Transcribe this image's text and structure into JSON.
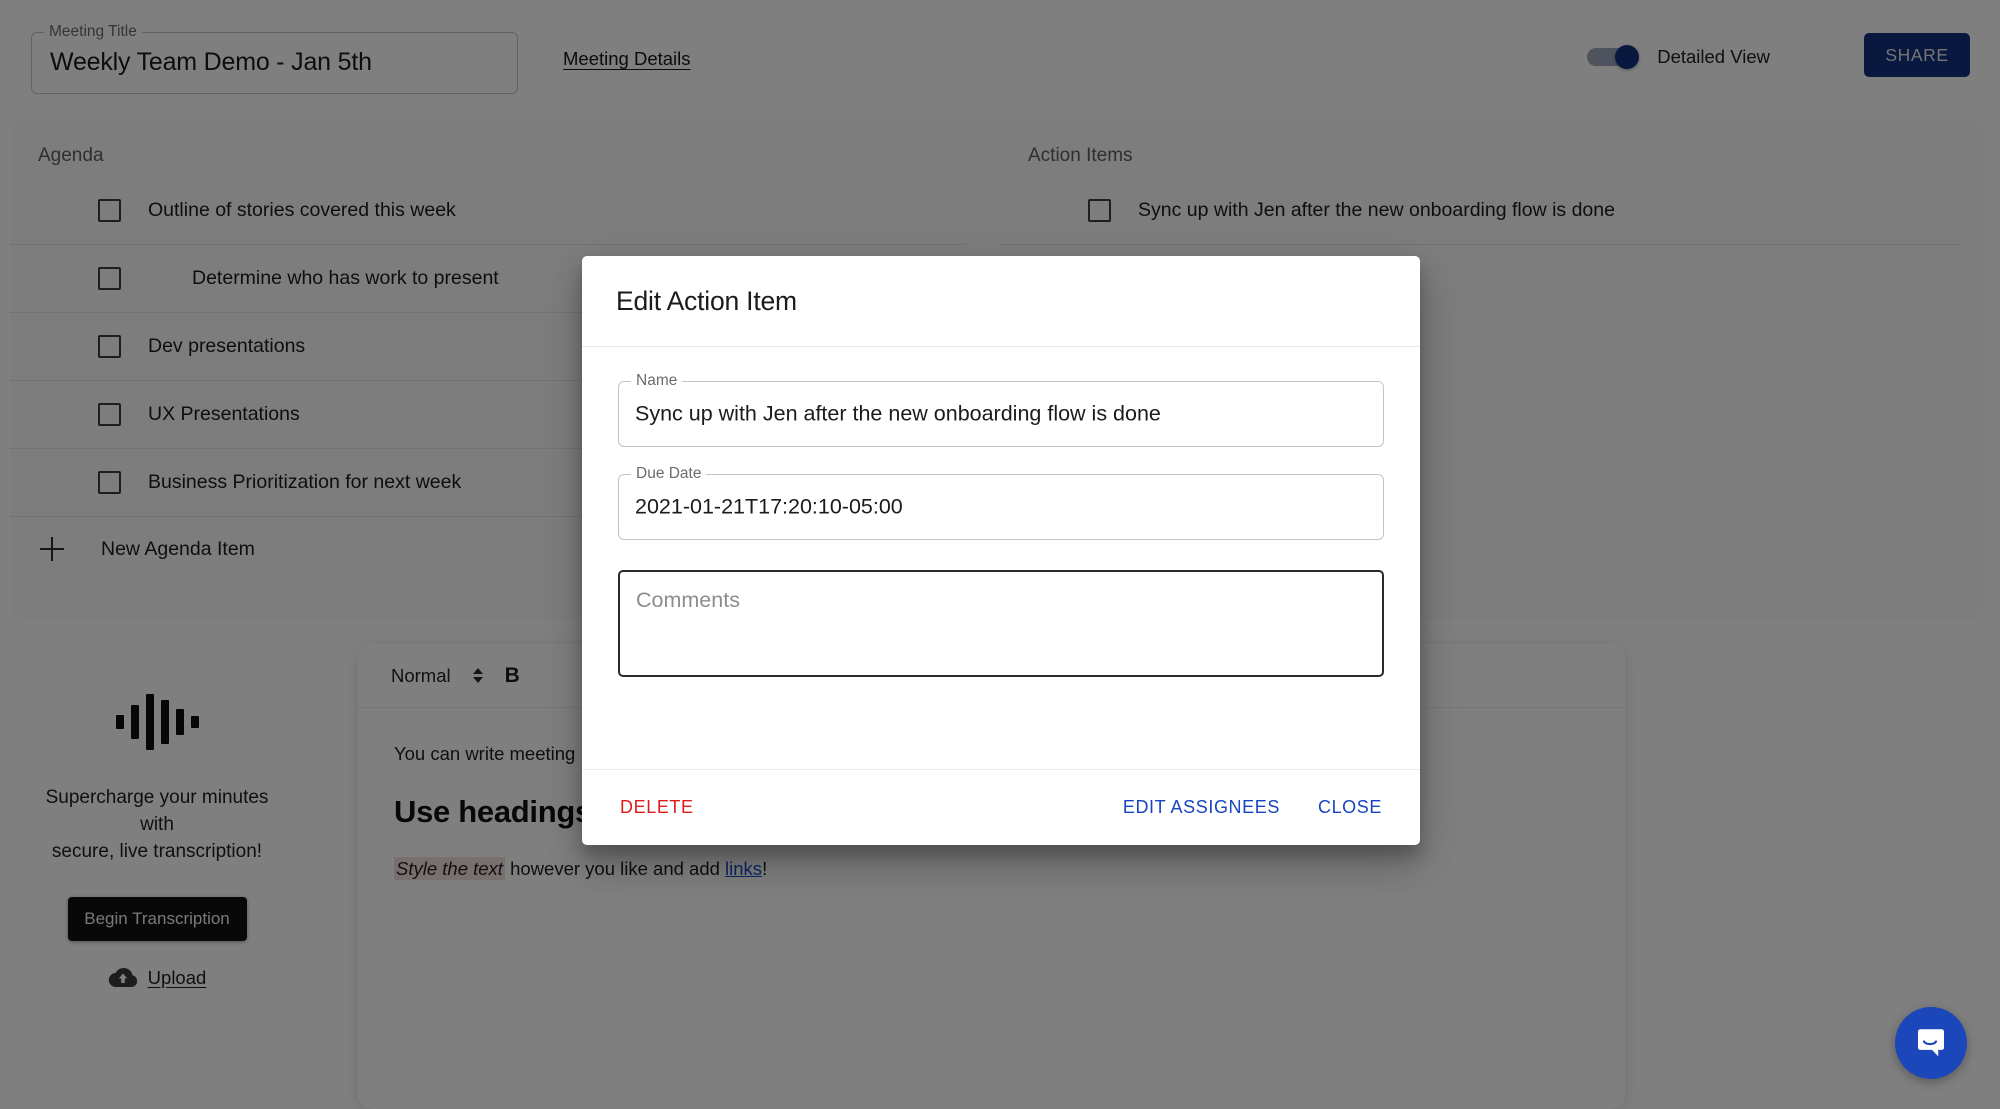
{
  "header": {
    "title_label": "Meeting Title",
    "title_value": "Weekly Team Demo - Jan 5th",
    "details_link": "Meeting Details",
    "toggle_label": "Detailed View",
    "toggle_on": true,
    "share_label": "SHARE",
    "share_color": "#11307e"
  },
  "agenda": {
    "heading": "Agenda",
    "items": [
      {
        "label": "Outline of stories covered this week",
        "checked": false,
        "indent": false
      },
      {
        "label": "Determine who has work to present",
        "checked": false,
        "indent": true
      },
      {
        "label": "Dev presentations",
        "checked": false,
        "indent": false
      },
      {
        "label": "UX Presentations",
        "checked": false,
        "indent": false
      },
      {
        "label": "Business Prioritization for next week",
        "checked": false,
        "indent": false
      }
    ],
    "new_item_label": "New Agenda Item"
  },
  "action_items": {
    "heading": "Action Items",
    "items": [
      {
        "label": "Sync up with Jen after the new onboarding flow is done",
        "checked": false
      }
    ]
  },
  "transcription": {
    "promo_line1": "Supercharge your minutes with",
    "promo_line2": "secure, live transcription!",
    "begin_label": "Begin Transcription",
    "upload_label": "Upload",
    "waveform_bars": [
      14,
      34,
      56,
      44,
      26,
      12
    ]
  },
  "editor": {
    "style_select_value": "Normal",
    "bold_label": "B",
    "paragraph": "You can write meeting",
    "heading": "Use headings fo",
    "styled_text": "Style the text",
    "after_styled": " however you like and add ",
    "link_text": "links",
    "trailing": "!"
  },
  "modal": {
    "title": "Edit Action Item",
    "name_label": "Name",
    "name_value": "Sync up with Jen after the new onboarding flow is done",
    "due_label": "Due Date",
    "due_value": "2021-01-21T17:20:10-05:00",
    "comments_placeholder": "Comments",
    "delete_label": "DELETE",
    "edit_assignees_label": "EDIT ASSIGNEES",
    "close_label": "CLOSE",
    "delete_color": "#e01b1b",
    "link_color": "#1744c2"
  },
  "chat": {
    "launcher_color": "#1b47ba"
  }
}
